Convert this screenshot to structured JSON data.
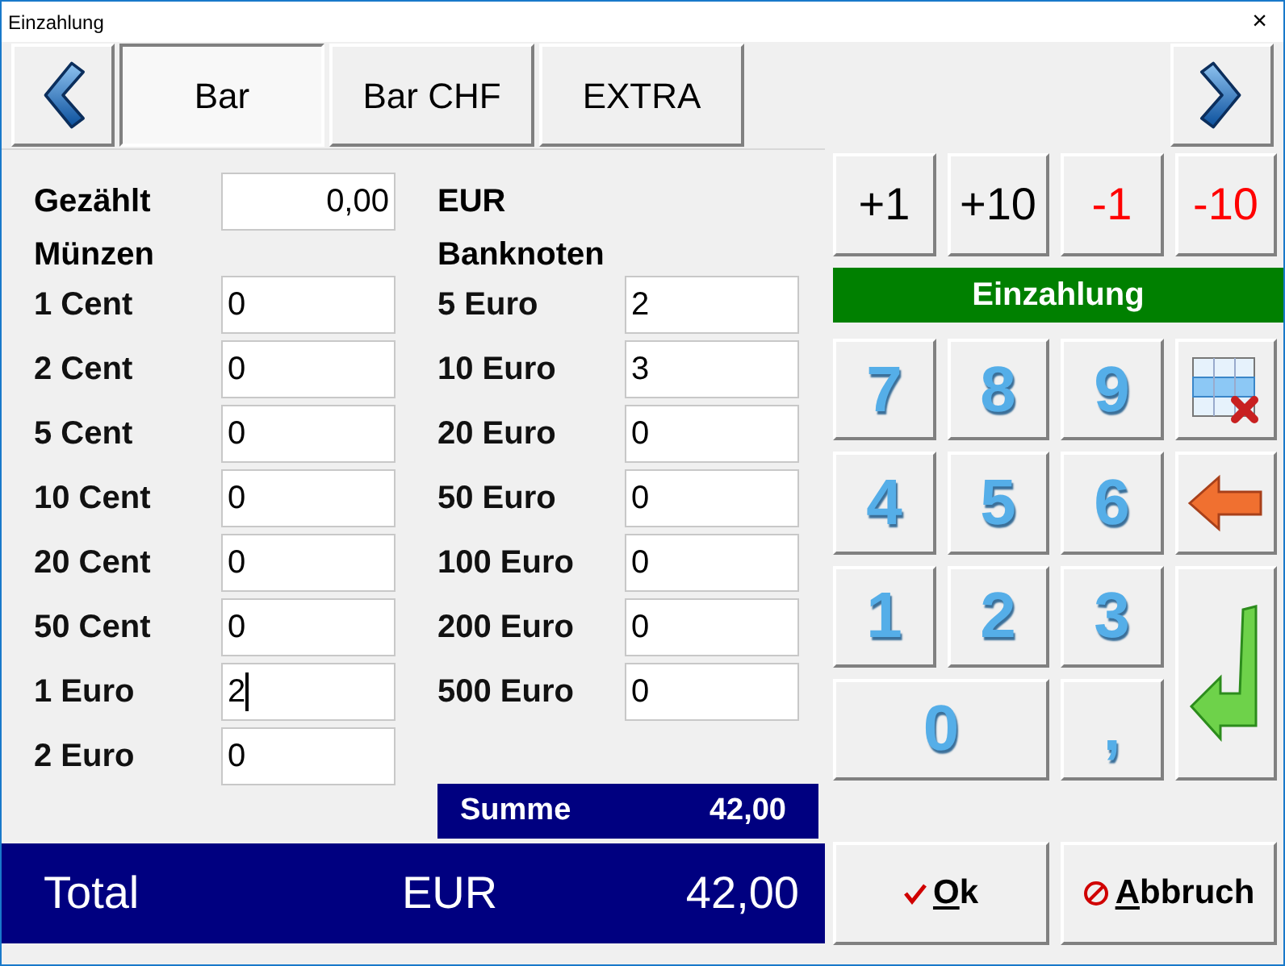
{
  "window": {
    "title": "Einzahlung",
    "close": "×"
  },
  "tabs": [
    {
      "label": "Bar",
      "selected": true
    },
    {
      "label": "Bar CHF",
      "selected": false
    },
    {
      "label": "EXTRA",
      "selected": false
    }
  ],
  "counted": {
    "label": "Gezählt",
    "value": "0,00",
    "currency": "EUR"
  },
  "coins": {
    "title": "Münzen",
    "rows": [
      {
        "label": "1 Cent",
        "value": "0",
        "focused": false
      },
      {
        "label": "2 Cent",
        "value": "0",
        "focused": false
      },
      {
        "label": "5 Cent",
        "value": "0",
        "focused": false
      },
      {
        "label": "10 Cent",
        "value": "0",
        "focused": false
      },
      {
        "label": "20 Cent",
        "value": "0",
        "focused": false
      },
      {
        "label": "50 Cent",
        "value": "0",
        "focused": false
      },
      {
        "label": "1 Euro",
        "value": "2",
        "focused": true
      },
      {
        "label": "2 Euro",
        "value": "0",
        "focused": false
      }
    ]
  },
  "notes": {
    "title": "Banknoten",
    "rows": [
      {
        "label": "5 Euro",
        "value": "2",
        "focused": false
      },
      {
        "label": "10 Euro",
        "value": "3",
        "focused": false
      },
      {
        "label": "20 Euro",
        "value": "0",
        "focused": false
      },
      {
        "label": "50 Euro",
        "value": "0",
        "focused": false
      },
      {
        "label": "100 Euro",
        "value": "0",
        "focused": false
      },
      {
        "label": "200 Euro",
        "value": "0",
        "focused": false
      },
      {
        "label": "500 Euro",
        "value": "0",
        "focused": false
      }
    ]
  },
  "sum": {
    "label": "Summe",
    "value": "42,00"
  },
  "total": {
    "label": "Total",
    "currency": "EUR",
    "value": "42,00"
  },
  "steps": [
    {
      "label": "+1",
      "negative": false
    },
    {
      "label": "+10",
      "negative": false
    },
    {
      "label": "-1",
      "negative": true
    },
    {
      "label": "-10",
      "negative": true
    }
  ],
  "mode": "Einzahlung",
  "keys": [
    {
      "kind": "digit",
      "label": "7"
    },
    {
      "kind": "digit",
      "label": "8"
    },
    {
      "kind": "digit",
      "label": "9"
    },
    {
      "kind": "clear"
    },
    {
      "kind": "digit",
      "label": "4"
    },
    {
      "kind": "digit",
      "label": "5"
    },
    {
      "kind": "digit",
      "label": "6"
    },
    {
      "kind": "backspace"
    },
    {
      "kind": "digit",
      "label": "1"
    },
    {
      "kind": "digit",
      "label": "2"
    },
    {
      "kind": "digit",
      "label": "3"
    },
    {
      "kind": "enter"
    },
    {
      "kind": "zero",
      "label": "0"
    },
    {
      "kind": "digit",
      "label": ","
    }
  ],
  "buttons": [
    {
      "kind": "ok",
      "label": "Ok",
      "mnemonic_underlined": true
    },
    {
      "kind": "cancel",
      "label": "Abbruch",
      "mnemonic_underlined": true
    }
  ]
}
